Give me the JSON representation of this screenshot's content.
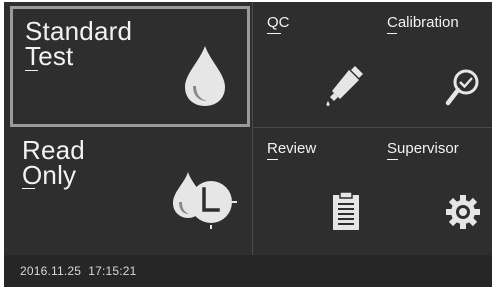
{
  "tiles": {
    "standard_test": {
      "line1": "Standard",
      "line2": "Test"
    },
    "read_only": {
      "line1": "Read",
      "line2": "Only"
    },
    "qc": {
      "label": "QC"
    },
    "calibration": {
      "label": "Calibration"
    },
    "review": {
      "label": "Review"
    },
    "supervisor": {
      "label": "Supervisor"
    }
  },
  "status": {
    "datetime": "2016.11.25  17:15:21"
  },
  "icons": {
    "standard_test": "drop-icon",
    "read_only": "drop-clock-icon",
    "qc": "dropper-icon",
    "calibration": "magnifier-check-icon",
    "review": "clipboard-icon",
    "supervisor": "gear-icon"
  },
  "colors": {
    "background": "#2e2e2e",
    "selected_border": "#9a9a9a",
    "text": "#f2f2f2"
  }
}
